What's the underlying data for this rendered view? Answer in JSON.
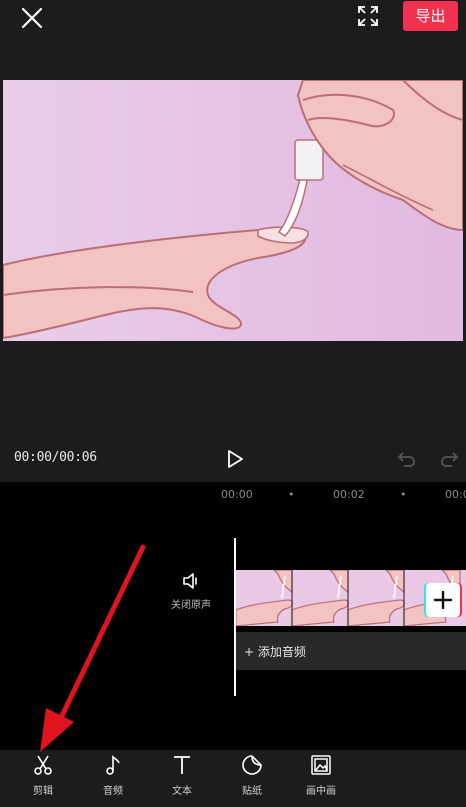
{
  "header": {
    "export_label": "导出"
  },
  "player": {
    "timecode": "00:00/00:06"
  },
  "timeline": {
    "ticks": [
      "00:00",
      "•",
      "00:02",
      "•",
      "00:0"
    ],
    "mute_label": "关闭原声",
    "add_audio_label": "+ 添加音频"
  },
  "toolbar": {
    "items": [
      {
        "label": "剪辑",
        "icon": "scissors-icon"
      },
      {
        "label": "音频",
        "icon": "music-note-icon"
      },
      {
        "label": "文本",
        "icon": "text-icon"
      },
      {
        "label": "贴纸",
        "icon": "sticker-icon"
      },
      {
        "label": "画中画",
        "icon": "picture-in-picture-icon"
      }
    ]
  },
  "colors": {
    "accent": "#f0324f",
    "background": "#1c1c1e",
    "annotation_arrow": "#e0141e"
  }
}
